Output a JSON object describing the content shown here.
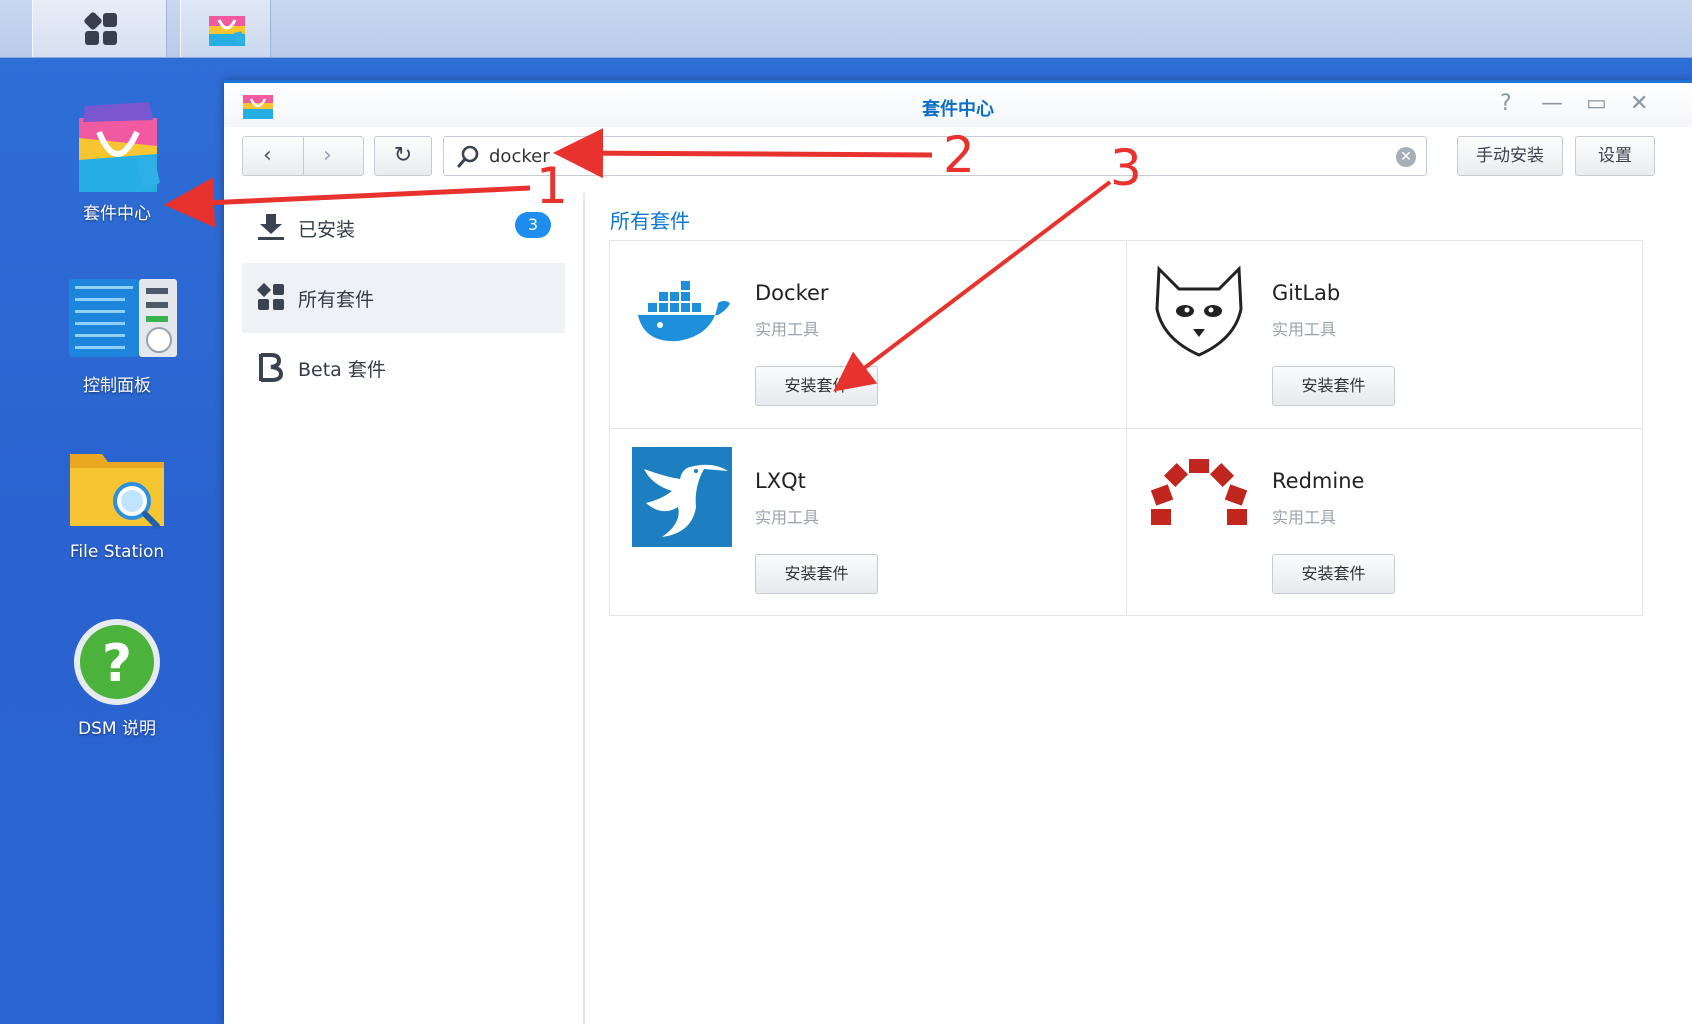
{
  "taskbar": {
    "main_menu_icon": "grid-icon",
    "active_app_icon": "package-center-icon"
  },
  "desktop": {
    "icons": [
      {
        "label": "套件中心",
        "icon": "package-center-icon"
      },
      {
        "label": "控制面板",
        "icon": "control-panel-icon"
      },
      {
        "label": "File Station",
        "icon": "folder-search-icon"
      },
      {
        "label": "DSM 说明",
        "icon": "help-icon"
      }
    ]
  },
  "window": {
    "title": "套件中心",
    "controls": {
      "help": "?",
      "minimize": "—",
      "maximize": "▭",
      "close": "✕"
    }
  },
  "toolbar": {
    "back": "‹",
    "forward": "›",
    "refresh": "↻",
    "search_value": "docker",
    "manual_install_label": "手动安装",
    "settings_label": "设置"
  },
  "sidebar": {
    "items": [
      {
        "label": "已安装",
        "icon": "download-icon",
        "badge": "3"
      },
      {
        "label": "所有套件",
        "icon": "grid-icon"
      },
      {
        "label": "Beta 套件",
        "icon": "beta-icon"
      }
    ]
  },
  "content": {
    "section_title": "所有套件",
    "packages": [
      {
        "name": "Docker",
        "category": "实用工具",
        "button": "安装套件",
        "icon": "docker-whale-icon"
      },
      {
        "name": "GitLab",
        "category": "实用工具",
        "button": "安装套件",
        "icon": "gitlab-cat-icon"
      },
      {
        "name": "LXQt",
        "category": "实用工具",
        "button": "安装套件",
        "icon": "lxqt-bird-icon"
      },
      {
        "name": "Redmine",
        "category": "实用工具",
        "button": "安装套件",
        "icon": "redmine-arch-icon"
      }
    ]
  },
  "annotations": {
    "step1": "1",
    "step2": "2",
    "step3": "3",
    "arrow_color": "#e8322e"
  }
}
